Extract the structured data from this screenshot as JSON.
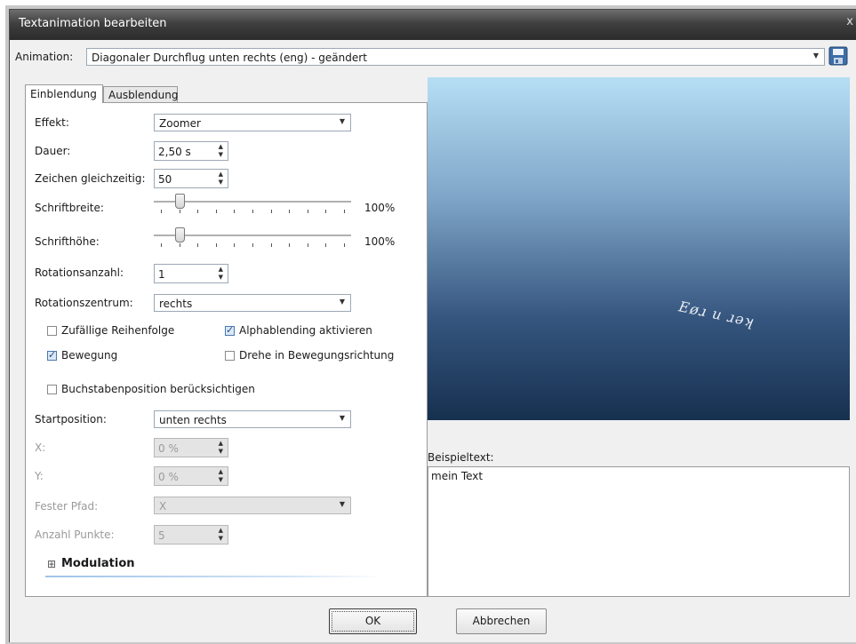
{
  "window": {
    "title": "Textanimation bearbeiten",
    "close_symbol": "x"
  },
  "animation": {
    "label": "Animation:",
    "value": "Diagonaler Durchflug unten rechts (eng) - geändert"
  },
  "tabs": [
    {
      "label": "Einblendung",
      "active": true
    },
    {
      "label": "Ausblendung",
      "active": false
    }
  ],
  "fields": {
    "effekt": {
      "label": "Effekt:",
      "value": "Zoomer"
    },
    "dauer": {
      "label": "Dauer:",
      "value": "2,50 s"
    },
    "zeichen": {
      "label": "Zeichen gleichzeitig:",
      "value": "50"
    },
    "schriftbreite": {
      "label": "Schriftbreite:",
      "value": "100%",
      "level": 0.1
    },
    "schrifthoehe": {
      "label": "Schrifthöhe:",
      "value": "100%",
      "level": 0.1
    },
    "rotationsanzahl": {
      "label": "Rotationsanzahl:",
      "value": "1"
    },
    "rotationszentrum": {
      "label": "Rotationszentrum:",
      "value": "rechts"
    },
    "startposition": {
      "label": "Startposition:",
      "value": "unten rechts"
    },
    "x": {
      "label": "X:",
      "value": "0 %"
    },
    "y": {
      "label": "Y:",
      "value": "0 %"
    },
    "fester_pfad": {
      "label": "Fester Pfad:",
      "value": "X"
    },
    "anzahl_punkte": {
      "label": "Anzahl Punkte:",
      "value": "5"
    }
  },
  "checkboxes": {
    "zufaellig": {
      "label": "Zufällige Reihenfolge",
      "checked": false
    },
    "alphablending": {
      "label": "Alphablending aktivieren",
      "checked": true
    },
    "bewegung": {
      "label": "Bewegung",
      "checked": true
    },
    "drehe": {
      "label": "Drehe in Bewegungsrichtung",
      "checked": false
    },
    "buchstabenposition": {
      "label": "Buchstabenposition berücksichtigen",
      "checked": false
    }
  },
  "modulation": {
    "expander": "⊞",
    "label": "Modulation"
  },
  "preview": {
    "text": "Eøɹ u ɹəʞ"
  },
  "beispieltext": {
    "label": "Beispieltext:",
    "value": "mein Text"
  },
  "buttons": {
    "ok": "OK",
    "abbrechen": "Abbrechen"
  },
  "icons": {
    "save": "floppy-disk-icon",
    "dropdown": "chevron-down-icon",
    "spinner": "spinner-arrows-icon"
  }
}
